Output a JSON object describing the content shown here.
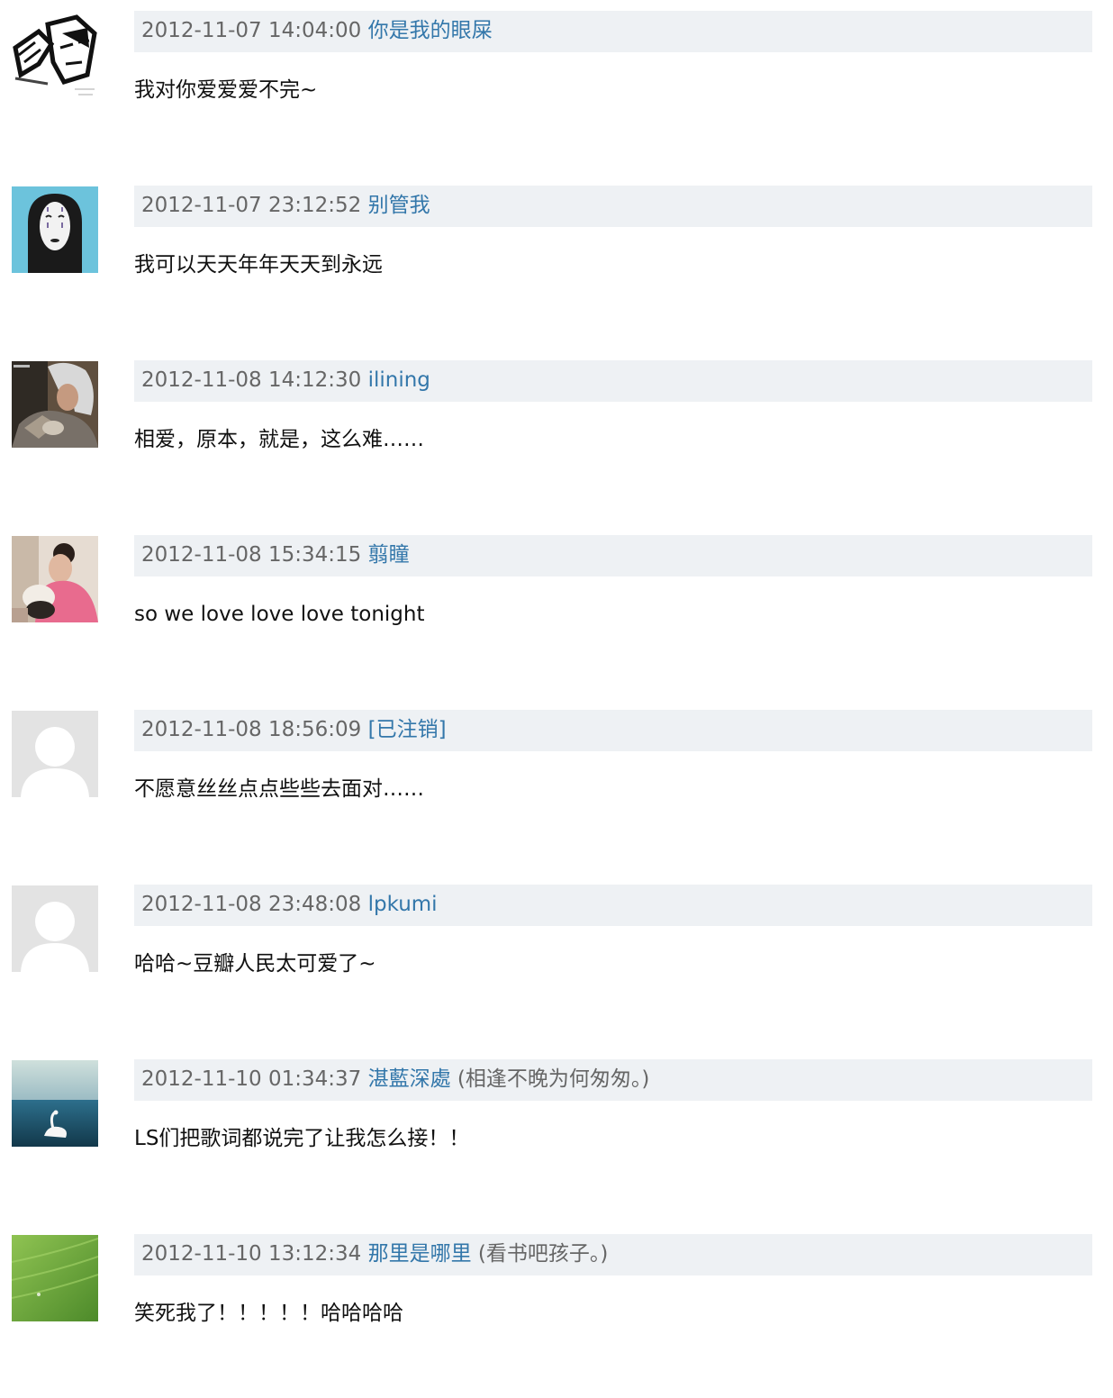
{
  "comments": [
    {
      "avatar_icon": "sketch-faces-avatar-icon",
      "time": "2012-11-07 14:04:00",
      "author": "你是我的眼屎",
      "signature": "",
      "text": "我对你爱爱爱不完~"
    },
    {
      "avatar_icon": "no-face-mask-avatar-icon",
      "time": "2012-11-07 23:12:52",
      "author": "别管我",
      "signature": "",
      "text": "我可以天天年年天天到永远"
    },
    {
      "avatar_icon": "silver-hair-portrait-avatar-icon",
      "time": "2012-11-08 14:12:30",
      "author": "ilining",
      "signature": "",
      "text": "相爱，原本，就是，这么难……"
    },
    {
      "avatar_icon": "woman-with-pet-avatar-icon",
      "time": "2012-11-08 15:34:15",
      "author": "翦瞳",
      "signature": "",
      "text": "so we love love love tonight"
    },
    {
      "avatar_icon": "default-user-avatar-icon",
      "time": "2012-11-08 18:56:09",
      "author": "[已注销]",
      "signature": "",
      "text": "不愿意丝丝点点些些去面对……"
    },
    {
      "avatar_icon": "default-user-avatar-icon",
      "time": "2012-11-08 23:48:08",
      "author": "lpkumi",
      "signature": "",
      "text": "哈哈~豆瓣人民太可爱了~"
    },
    {
      "avatar_icon": "swan-on-lake-avatar-icon",
      "time": "2012-11-10 01:34:37",
      "author": "湛藍深處",
      "signature": "(相逢不晚为何匆匆。)",
      "text": "LS们把歌词都说完了让我怎么接！！"
    },
    {
      "avatar_icon": "green-field-avatar-icon",
      "time": "2012-11-10 13:12:34",
      "author": "那里是哪里",
      "signature": "(看书吧孩子。)",
      "text": "笑死我了！！！！！哈哈哈哈"
    }
  ]
}
